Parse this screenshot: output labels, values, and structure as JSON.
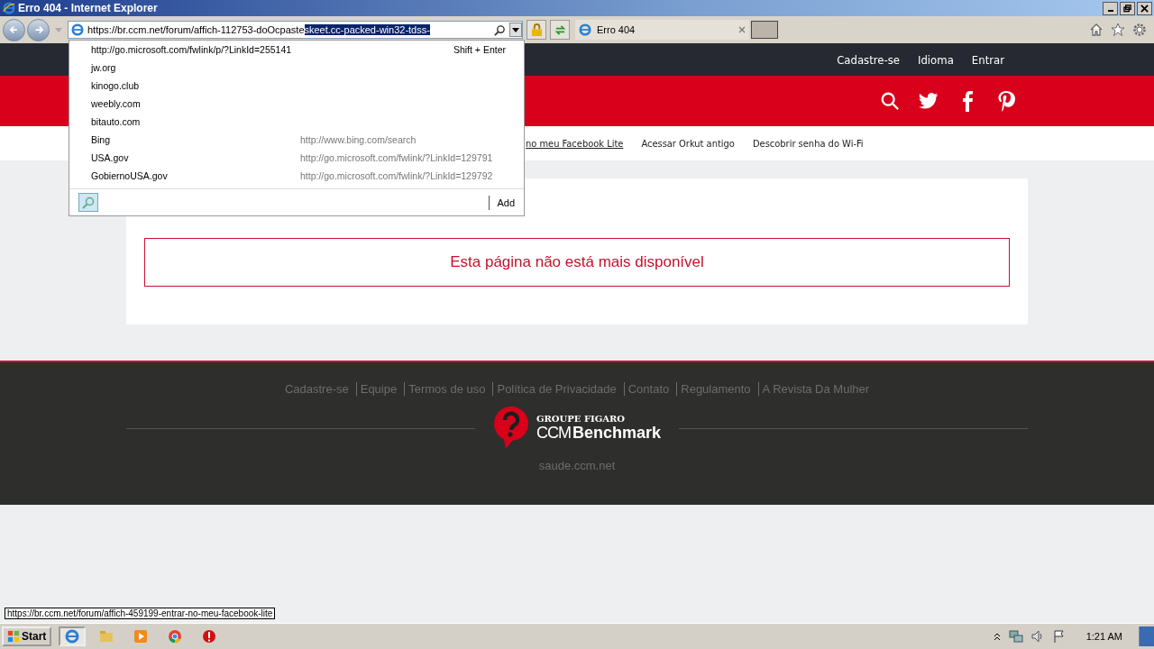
{
  "window": {
    "title": "Erro 404 - Internet Explorer"
  },
  "address_bar": {
    "url": "https://br.ccm.net/forum/affich-112753-doOcpaste",
    "url_selected": "skeet.cc-packed-win32-tdss-"
  },
  "tabs": [
    {
      "label": "Erro 404",
      "selected": true
    }
  ],
  "address_dropdown": {
    "items": [
      {
        "text": "http://go.microsoft.com/fwlink/p/?LinkId=255141",
        "hint": "Shift + Enter",
        "kind": "shortcut"
      },
      {
        "text": "jw.org",
        "kind": "site"
      },
      {
        "text": "kinogo.club",
        "kind": "site"
      },
      {
        "text": "weebly.com",
        "kind": "site"
      },
      {
        "text": "bitauto.com",
        "kind": "site"
      },
      {
        "text": "Bing",
        "hint": "http://www.bing.com/search",
        "kind": "provider"
      },
      {
        "text": "USA.gov",
        "hint": "http://go.microsoft.com/fwlink/?LinkId=129791",
        "kind": "provider"
      },
      {
        "text": "GobiernoUSA.gov",
        "hint": "http://go.microsoft.com/fwlink/?LinkId=129792",
        "kind": "provider"
      }
    ],
    "add_label": "Add"
  },
  "top_bar": {
    "links": [
      "Cadastre-se",
      "Idioma",
      "Entrar"
    ]
  },
  "sub_nav": [
    {
      "label": "no meu Facebook Lite",
      "underlined": true
    },
    {
      "label": "Acessar Orkut antigo",
      "underlined": false
    },
    {
      "label": "Descobrir senha do Wi-Fi",
      "underlined": false
    }
  ],
  "card": {
    "message": "Esta página não está mais disponível"
  },
  "footer": {
    "links": [
      "Cadastre-se",
      "Equipe",
      "Termos de uso",
      "Política de Privacidade",
      "Contato",
      "Regulamento",
      "A Revista Da Mulher"
    ],
    "logo_top": "GROUPE FIGARO",
    "logo_main": "CCM",
    "logo_brand": "Benchmark",
    "site": "saude.ccm.net"
  },
  "status_tooltip": "https://br.ccm.net/forum/affich-459199-entrar-no-meu-facebook-lite",
  "taskbar": {
    "start": "Start",
    "clock": "1:21 AM"
  }
}
